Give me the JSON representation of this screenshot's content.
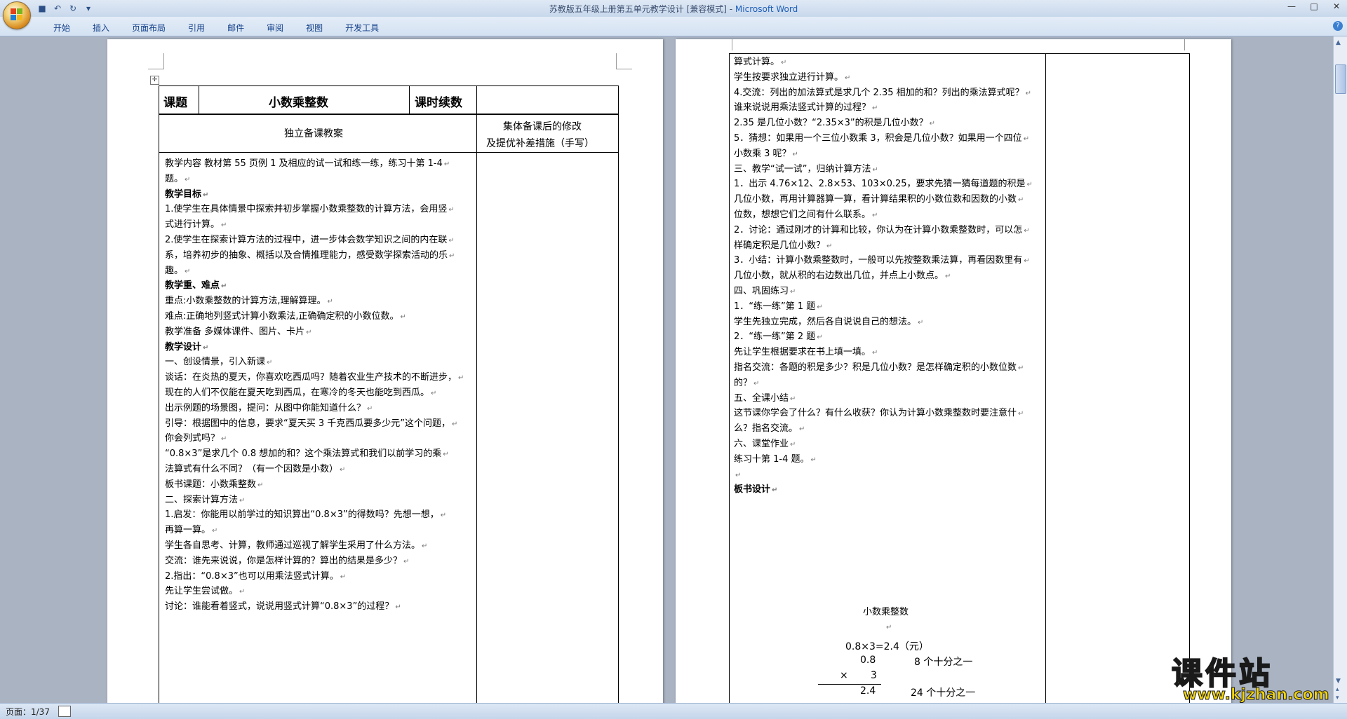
{
  "window": {
    "title": "苏教版五年级上册第五单元教学设计 [兼容模式] - ",
    "app_name": "Microsoft Word",
    "controls": [
      "—",
      "□",
      "✕"
    ]
  },
  "ribbon": {
    "tabs": [
      "开始",
      "插入",
      "页面布局",
      "引用",
      "邮件",
      "审阅",
      "视图",
      "开发工具"
    ],
    "help": "?"
  },
  "page1": {
    "header": {
      "label_topic": "课题",
      "topic": "小数乘整数",
      "label_hours": "课时续数",
      "hours": ""
    },
    "columns": {
      "left": "独立备课教案",
      "right_line1": "集体备课后的修改",
      "right_line2": "及提优补差措施（手写）"
    },
    "paragraphs": [
      {
        "text": "教学内容   教材第 55 页例 1 及相应的试一试和练一练，练习十第 1-4",
        "bold": false
      },
      {
        "text": "题。",
        "bold": false
      },
      {
        "text": "教学目标",
        "bold": true
      },
      {
        "text": "1.使学生在具体情景中探索并初步掌握小数乘整数的计算方法，会用竖",
        "bold": false
      },
      {
        "text": "式进行计算。",
        "bold": false
      },
      {
        "text": "2.使学生在探索计算方法的过程中，进一步体会数学知识之间的内在联",
        "bold": false
      },
      {
        "text": "系，培养初步的抽象、概括以及合情推理能力，感受数学探索活动的乐",
        "bold": false
      },
      {
        "text": "趣。",
        "bold": false
      },
      {
        "text": "教学重、难点",
        "bold": true
      },
      {
        "text": "重点:小数乘整数的计算方法,理解算理。",
        "bold": false
      },
      {
        "text": "难点:正确地列竖式计算小数乘法,正确确定积的小数位数。",
        "bold": false
      },
      {
        "text": "教学准备   多媒体课件、图片、卡片",
        "bold": false
      },
      {
        "text": "教学设计",
        "bold": true
      },
      {
        "text": "一、创设情景，引入新课",
        "bold": false
      },
      {
        "text": "谈话：在炎热的夏天，你喜欢吃西瓜吗？随着农业生产技术的不断进步，",
        "bold": false
      },
      {
        "text": "现在的人们不仅能在夏天吃到西瓜，在寒冷的冬天也能吃到西瓜。",
        "bold": false
      },
      {
        "text": "出示例题的场景图，提问：从图中你能知道什么？",
        "bold": false
      },
      {
        "text": "引导：根据图中的信息，要求“夏天买 3 千克西瓜要多少元”这个问题，",
        "bold": false
      },
      {
        "text": "你会列式吗？",
        "bold": false
      },
      {
        "text": "“0.8×3”是求几个 0.8 想加的和？这个乘法算式和我们以前学习的乘",
        "bold": false
      },
      {
        "text": "法算式有什么不同？（有一个因数是小数）",
        "bold": false
      },
      {
        "text": "板书课题：小数乘整数",
        "bold": false
      },
      {
        "text": "二、探索计算方法",
        "bold": false
      },
      {
        "text": "1.启发：你能用以前学过的知识算出“0.8×3”的得数吗？先想一想，",
        "bold": false
      },
      {
        "text": "再算一算。",
        "bold": false
      },
      {
        "text": "学生各自思考、计算，教师通过巡视了解学生采用了什么方法。",
        "bold": false
      },
      {
        "text": "交流：谁先来说说，你是怎样计算的？算出的结果是多少？",
        "bold": false
      },
      {
        "text": "2.指出：“0.8×3”也可以用乘法竖式计算。",
        "bold": false
      },
      {
        "text": "先让学生尝试做。",
        "bold": false
      },
      {
        "text": "讨论：谁能看着竖式，说说用竖式计算“0.8×3”的过程？",
        "bold": false
      }
    ]
  },
  "page2": {
    "paragraphs": [
      "算式计算。",
      "学生按要求独立进行计算。",
      "4.交流：列出的加法算式是求几个 2.35 相加的和？列出的乘法算式呢？",
      "谁来说说用乘法竖式计算的过程？",
      "2.35 是几位小数？“2.35×3”的积是几位小数？",
      "5．猜想：如果用一个三位小数乘 3，积会是几位小数？如果用一个四位",
      "小数乘 3 呢？",
      "三、教学“试一试”，归纳计算方法",
      "1．出示 4.76×12、2.8×53、103×0.25，要求先猜一猜每道题的积是",
      "几位小数，再用计算器算一算，看计算结果积的小数位数和因数的小数",
      "位数，想想它们之间有什么联系。",
      "2．讨论：通过刚才的计算和比较，你认为在计算小数乘整数时，可以怎",
      "样确定积是几位小数？",
      "3．小结：计算小数乘整数时，一般可以先按整数乘法算，再看因数里有",
      "几位小数，就从积的右边数出几位，并点上小数点。",
      "四、巩固练习",
      "1．“练一练”第 1 题",
      "学生先独立完成，然后各自说说自己的想法。",
      "2．“练一练”第 2 题",
      "先让学生根据要求在书上填一填。",
      "指名交流：各题的积是多少？积是几位小数？是怎样确定积的小数位数",
      "的？",
      "五、全课小结",
      "这节课你学会了什么？有什么收获？你认为计算小数乘整数时要注意什",
      "么？指名交流。",
      "六、课堂作业",
      "练习十第 1-4 题。",
      "",
      "板书设计"
    ],
    "board": {
      "title": "小数乘整数",
      "equation": "0.8×3=2.4（元）",
      "row1_num": "0.8",
      "row1_note": "8 个十分之一",
      "row2_op": "×",
      "row2_num": "3",
      "row3_num": "2.4",
      "row3_note": "24 个十分之一"
    }
  },
  "statusbar": {
    "page": "页面：1/37"
  },
  "watermark": {
    "text": "课件站",
    "url": "www.kjzhan.com"
  },
  "colors": {
    "titlebar": "#d3e1f1",
    "ribbon_text": "#15428b",
    "app_name": "#1f5fb8",
    "workspace": "#a9b3c2",
    "watermark": "#f5d60a"
  }
}
